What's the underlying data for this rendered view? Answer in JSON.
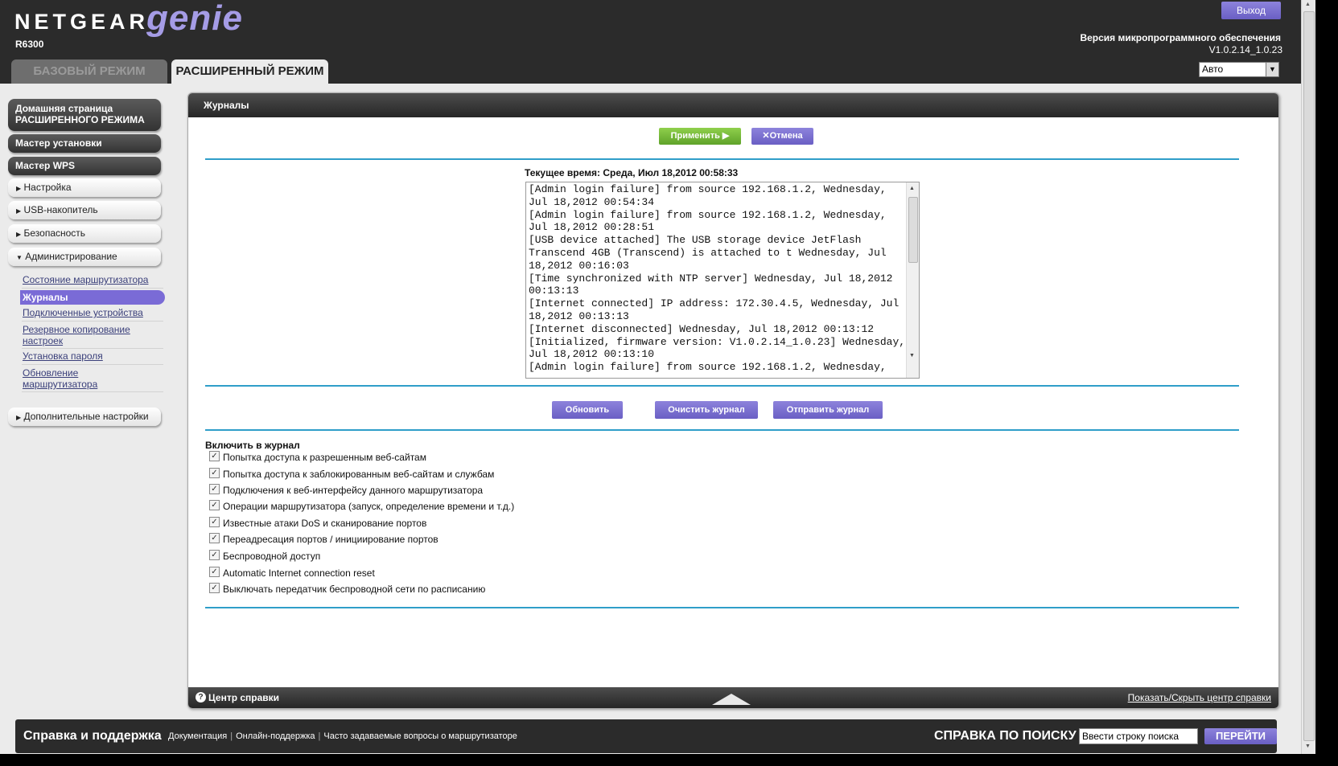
{
  "header": {
    "brand": "NETGEAR",
    "product": "genie",
    "trademark": "™",
    "model": "R6300",
    "tab_basic": "БАЗОВЫЙ РЕЖИМ",
    "tab_advanced": "РАСШИРЕННЫЙ РЕЖИМ",
    "logout": "Выход",
    "firmware_label": "Версия микропрограммного обеспечения",
    "firmware_version": "V1.0.2.14_1.0.23",
    "language_selected": "Авто"
  },
  "sidebar": {
    "home": "Домашняя страница РАСШИРЕННОГО РЕЖИМА",
    "setup_wizard": "Мастер установки",
    "wps_wizard": "Мастер WPS",
    "sections": [
      {
        "label": "Настройка",
        "arrow": "▶"
      },
      {
        "label": "USB-накопитель",
        "arrow": "▶"
      },
      {
        "label": "Безопасность",
        "arrow": "▶"
      },
      {
        "label": "Администрирование",
        "arrow": "▼"
      },
      {
        "label": "Дополнительные настройки",
        "arrow": "▶"
      }
    ],
    "admin_items": [
      "Состояние маршрутизатора",
      "Журналы",
      "Подключенные устройства",
      "Резервное копирование настроек",
      "Установка пароля",
      "Обновление маршрутизатора"
    ]
  },
  "main": {
    "title": "Журналы",
    "apply": "Применить ▶",
    "cancel": "✕Отмена",
    "current_time": "Текущее время: Среда, Июл 18,2012 00:58:33",
    "log": "[Admin login failure] from source 192.168.1.2, Wednesday,\nJul 18,2012 00:54:34\n[Admin login failure] from source 192.168.1.2, Wednesday,\nJul 18,2012 00:28:51\n[USB device attached] The USB storage device JetFlash\nTranscend 4GB (Transcend) is attached to t Wednesday, Jul\n18,2012 00:16:03\n[Time synchronized with NTP server] Wednesday, Jul 18,2012\n00:13:13\n[Internet connected] IP address: 172.30.4.5, Wednesday, Jul\n18,2012 00:13:13\n[Internet disconnected] Wednesday, Jul 18,2012 00:13:12\n[Initialized, firmware version: V1.0.2.14_1.0.23] Wednesday,\nJul 18,2012 00:13:10\n[Admin login failure] from source 192.168.1.2, Wednesday,",
    "refresh": "Обновить",
    "clear_log": "Очистить журнал",
    "send_log": "Отправить журнал",
    "include_title": "Включить в журнал",
    "options": [
      {
        "label": "Попытка доступа к разрешенным веб-сайтам",
        "checked": true
      },
      {
        "label": "Попытка доступа к заблокированным веб-сайтам и службам",
        "checked": true
      },
      {
        "label": "Подключения к веб-интерфейсу данного маршрутизатора",
        "checked": true
      },
      {
        "label": "Операции маршрутизатора (запуск, определение времени и т.д.)",
        "checked": true
      },
      {
        "label": "Известные атаки DoS и сканирование портов",
        "checked": true
      },
      {
        "label": "Переадресация портов / инициирование портов",
        "checked": true
      },
      {
        "label": "Беспроводной доступ",
        "checked": true
      },
      {
        "label": "Automatic Internet connection reset",
        "checked": true
      },
      {
        "label": "Выключать передатчик беспроводной сети по расписанию",
        "checked": true
      }
    ],
    "help_center": "Центр справки",
    "help_toggle": "Показать/Скрыть центр справки"
  },
  "footer": {
    "support_title": "Справка и поддержка",
    "links": [
      "Документация",
      "Онлайн-поддержка",
      "Часто задаваемые вопросы о маршрутизаторе"
    ],
    "search_title": "СПРАВКА ПО ПОИСКУ",
    "search_placeholder": "Ввести строку поиска",
    "search_button": "ПЕРЕЙТИ"
  }
}
